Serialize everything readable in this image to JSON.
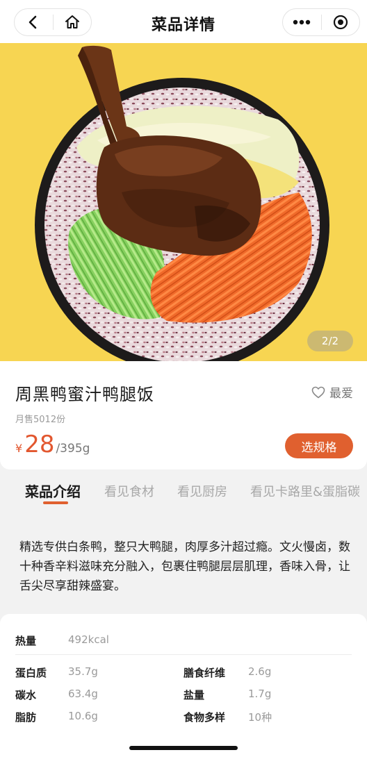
{
  "nav": {
    "title": "菜品详情"
  },
  "hero": {
    "pager": "2/2",
    "colors": {
      "background": "#f7d552"
    }
  },
  "dish": {
    "name": "周黑鸭蜜汁鸭腿饭",
    "favorite_label": "最爱",
    "sales": "月售5012份",
    "currency": "¥",
    "price": "28",
    "weight": "/395g",
    "spec_button": "选规格"
  },
  "tabs": [
    {
      "label": "菜品介绍"
    },
    {
      "label": "看见食材"
    },
    {
      "label": "看见厨房"
    },
    {
      "label": "看见卡路里&蛋脂碳"
    }
  ],
  "description": "精选专供白条鸭，整只大鸭腿，肉厚多汁超过瘾。文火慢卤，数十种香辛料滋味充分融入，包裹住鸭腿层层肌理，香味入骨，让舌尖尽享甜辣盛宴。",
  "nutrition": {
    "calories": {
      "label": "热量",
      "value": "492kcal"
    },
    "items": [
      {
        "label": "蛋白质",
        "value": "35.7g"
      },
      {
        "label": "膳食纤维",
        "value": "2.6g"
      },
      {
        "label": "碳水",
        "value": "63.4g"
      },
      {
        "label": "盐量",
        "value": "1.7g"
      },
      {
        "label": "脂肪",
        "value": "10.6g"
      },
      {
        "label": "食物多样",
        "value": "10种"
      }
    ]
  },
  "colors": {
    "accent": "#e0602f",
    "price": "#e2572f"
  }
}
